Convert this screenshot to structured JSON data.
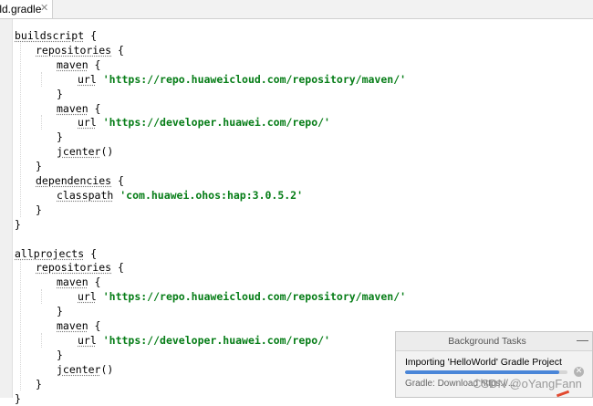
{
  "tab": {
    "label": "uild.gradle",
    "close_glyph": "✕"
  },
  "code": {
    "lines": [
      {
        "indent": 0,
        "parts": [
          {
            "t": "buildscript",
            "c": "kw"
          },
          {
            "t": " {",
            "c": ""
          }
        ]
      },
      {
        "indent": 1,
        "parts": [
          {
            "t": "repositories",
            "c": "kw"
          },
          {
            "t": " {",
            "c": ""
          }
        ]
      },
      {
        "indent": 2,
        "parts": [
          {
            "t": "maven",
            "c": "kw"
          },
          {
            "t": " {",
            "c": ""
          }
        ]
      },
      {
        "indent": 3,
        "parts": [
          {
            "t": "url",
            "c": "kw"
          },
          {
            "t": " ",
            "c": ""
          },
          {
            "t": "'https://repo.huaweicloud.com/repository/maven/'",
            "c": "str"
          }
        ]
      },
      {
        "indent": 2,
        "parts": [
          {
            "t": "}",
            "c": ""
          }
        ]
      },
      {
        "indent": 2,
        "parts": [
          {
            "t": "maven",
            "c": "kw"
          },
          {
            "t": " {",
            "c": ""
          }
        ]
      },
      {
        "indent": 3,
        "parts": [
          {
            "t": "url",
            "c": "kw"
          },
          {
            "t": " ",
            "c": ""
          },
          {
            "t": "'https://developer.huawei.com/repo/'",
            "c": "str"
          }
        ]
      },
      {
        "indent": 2,
        "parts": [
          {
            "t": "}",
            "c": ""
          }
        ]
      },
      {
        "indent": 2,
        "parts": [
          {
            "t": "jcenter",
            "c": "kw"
          },
          {
            "t": "()",
            "c": ""
          }
        ]
      },
      {
        "indent": 1,
        "parts": [
          {
            "t": "}",
            "c": ""
          }
        ]
      },
      {
        "indent": 1,
        "parts": [
          {
            "t": "dependencies",
            "c": "kw"
          },
          {
            "t": " {",
            "c": ""
          }
        ]
      },
      {
        "indent": 2,
        "parts": [
          {
            "t": "classpath",
            "c": "kw"
          },
          {
            "t": " ",
            "c": ""
          },
          {
            "t": "'com.huawei.ohos:hap:3.0.5.2'",
            "c": "str"
          }
        ]
      },
      {
        "indent": 1,
        "parts": [
          {
            "t": "}",
            "c": ""
          }
        ]
      },
      {
        "indent": 0,
        "parts": [
          {
            "t": "}",
            "c": ""
          }
        ]
      },
      {
        "indent": 0,
        "parts": []
      },
      {
        "indent": 0,
        "parts": [
          {
            "t": "allprojects",
            "c": "kw"
          },
          {
            "t": " {",
            "c": ""
          }
        ]
      },
      {
        "indent": 1,
        "parts": [
          {
            "t": "repositories",
            "c": "kw"
          },
          {
            "t": " {",
            "c": ""
          }
        ]
      },
      {
        "indent": 2,
        "parts": [
          {
            "t": "maven",
            "c": "kw"
          },
          {
            "t": " {",
            "c": ""
          }
        ]
      },
      {
        "indent": 3,
        "parts": [
          {
            "t": "url",
            "c": "kw"
          },
          {
            "t": " ",
            "c": ""
          },
          {
            "t": "'https://repo.huaweicloud.com/repository/maven/'",
            "c": "str"
          }
        ]
      },
      {
        "indent": 2,
        "parts": [
          {
            "t": "}",
            "c": ""
          }
        ]
      },
      {
        "indent": 2,
        "parts": [
          {
            "t": "maven",
            "c": "kw"
          },
          {
            "t": " {",
            "c": ""
          }
        ]
      },
      {
        "indent": 3,
        "parts": [
          {
            "t": "url",
            "c": "kw"
          },
          {
            "t": " ",
            "c": ""
          },
          {
            "t": "'https://developer.huawei.com/repo/'",
            "c": "str"
          }
        ]
      },
      {
        "indent": 2,
        "parts": [
          {
            "t": "}",
            "c": ""
          }
        ]
      },
      {
        "indent": 2,
        "parts": [
          {
            "t": "jcenter",
            "c": "kw"
          },
          {
            "t": "()",
            "c": ""
          }
        ]
      },
      {
        "indent": 1,
        "parts": [
          {
            "t": "}",
            "c": ""
          }
        ]
      },
      {
        "indent": 0,
        "parts": [
          {
            "t": "}",
            "c": ""
          }
        ]
      }
    ]
  },
  "background_tasks": {
    "title": "Background Tasks",
    "minimize_glyph": "—",
    "task_title": "Importing 'HelloWorld' Gradle Project",
    "progress": 0.95,
    "cancel_glyph": "✕",
    "status": "Gradle: Download https://..."
  },
  "watermark": "CSDN @oYangFann",
  "colors": {
    "string": "#067d17",
    "progress": "#4a86d8",
    "accent_mark": "#e2492f"
  }
}
